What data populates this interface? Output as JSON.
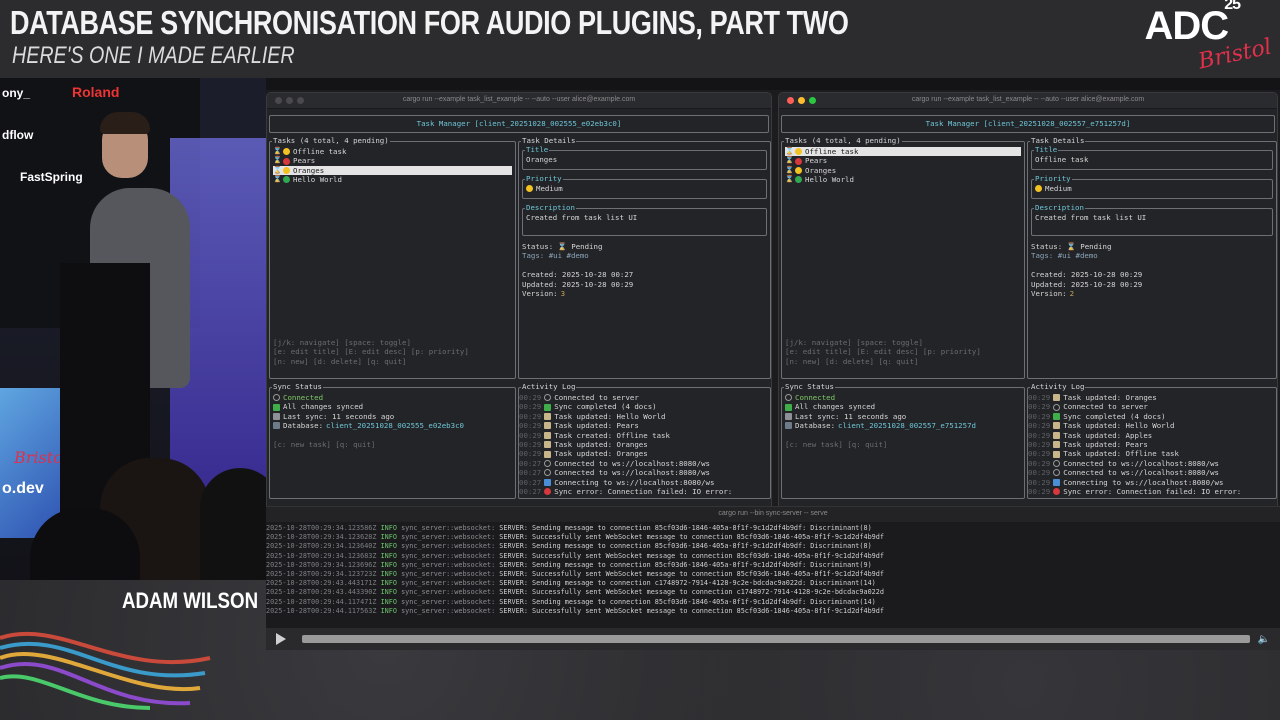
{
  "slide": {
    "title": "DATABASE SYNCHRONISATION FOR AUDIO PLUGINS, PART TWO",
    "subtitle": "HERE'S ONE I MADE EARLIER",
    "logo": "ADC",
    "logo_year": "25",
    "logo_city": "Bristol",
    "speaker_name": "ADAM WILSON",
    "sponsors": [
      "ony_",
      "Roland",
      "dflow",
      "FastSpring"
    ],
    "stage_text": [
      "Bristol",
      "o.dev"
    ]
  },
  "windows": [
    {
      "title": "cargo run --example task_list_example -- --auto --user alice@example.com",
      "active": false,
      "header": "Task Manager [client_20251028_002555_e02eb3c0]",
      "tasks_label": "Tasks (4 total, 4 pending)",
      "tasks": [
        {
          "name": "Offline task",
          "color": "yellow",
          "selected": false
        },
        {
          "name": "Pears",
          "color": "red",
          "selected": false
        },
        {
          "name": "Oranges",
          "color": "yellow",
          "selected": true
        },
        {
          "name": "Hello World",
          "color": "green",
          "selected": false
        }
      ],
      "help": [
        "[j/k: navigate] [space: toggle]",
        "[e: edit title] [E: edit desc] [p: priority]",
        "[n: new] [d: delete] [q: quit]"
      ],
      "details_label": "Task Details",
      "title_label": "Title",
      "title_value": "Oranges",
      "priority_label": "Priority",
      "priority_value": "Medium",
      "description_label": "Description",
      "description_value": "Created from task list UI",
      "status_line": "Status: ⌛ Pending",
      "tags_line": "Tags: #ui #demo",
      "created_line": "Created: 2025-10-28 00:27",
      "updated_line": "Updated: 2025-10-28 00:29",
      "version_label": "Version:",
      "version_value": "3",
      "sync_label": "Sync Status",
      "sync_connected": "Connected",
      "sync_changes": "All changes synced",
      "sync_last": "Last sync: 11 seconds ago",
      "sync_db_label": "Database:",
      "sync_db_value": "client_20251028_002555_e02eb3c0",
      "sync_help": "[c: new task] [q: quit]",
      "activity_label": "Activity Log",
      "activity": [
        {
          "ts": "00:29",
          "icon": "link",
          "text": "Connected to server"
        },
        {
          "ts": "00:29",
          "icon": "check",
          "text": "Sync completed (4 docs)"
        },
        {
          "ts": "00:29",
          "icon": "doc",
          "text": "Task updated: Hello World"
        },
        {
          "ts": "00:29",
          "icon": "doc",
          "text": "Task updated: Pears"
        },
        {
          "ts": "00:29",
          "icon": "doc",
          "text": "Task created: Offline task"
        },
        {
          "ts": "00:29",
          "icon": "doc",
          "text": "Task updated: Oranges"
        },
        {
          "ts": "00:29",
          "icon": "doc",
          "text": "Task updated: Oranges"
        },
        {
          "ts": "00:27",
          "icon": "link",
          "text": "Connected to ws://localhost:8080/ws"
        },
        {
          "ts": "00:27",
          "icon": "link",
          "text": "Connected to ws://localhost:8080/ws"
        },
        {
          "ts": "00:27",
          "icon": "blue",
          "text": "Connecting to ws://localhost:8080/ws"
        },
        {
          "ts": "00:27",
          "icon": "err",
          "text": "Sync error: Connection failed: IO error:"
        }
      ]
    },
    {
      "title": "cargo run --example task_list_example -- --auto --user alice@example.com",
      "active": true,
      "header": "Task Manager [client_20251028_002557_e751257d]",
      "tasks_label": "Tasks (4 total, 4 pending)",
      "tasks": [
        {
          "name": "Offline task",
          "color": "yellow",
          "selected": true
        },
        {
          "name": "Pears",
          "color": "red",
          "selected": false
        },
        {
          "name": "Oranges",
          "color": "yellow",
          "selected": false
        },
        {
          "name": "Hello World",
          "color": "green",
          "selected": false
        }
      ],
      "help": [
        "[j/k: navigate] [space: toggle]",
        "[e: edit title] [E: edit desc] [p: priority]",
        "[n: new] [d: delete] [q: quit]"
      ],
      "details_label": "Task Details",
      "title_label": "Title",
      "title_value": "Offline task",
      "priority_label": "Priority",
      "priority_value": "Medium",
      "description_label": "Description",
      "description_value": "Created from task list UI",
      "status_line": "Status: ⌛ Pending",
      "tags_line": "Tags: #ui #demo",
      "created_line": "Created: 2025-10-28 00:29",
      "updated_line": "Updated: 2025-10-28 00:29",
      "version_label": "Version:",
      "version_value": "2",
      "sync_label": "Sync Status",
      "sync_connected": "Connected",
      "sync_changes": "All changes synced",
      "sync_last": "Last sync: 11 seconds ago",
      "sync_db_label": "Database:",
      "sync_db_value": "client_20251028_002557_e751257d",
      "sync_help": "[c: new task] [q: quit]",
      "activity_label": "Activity Log",
      "activity": [
        {
          "ts": "00:29",
          "icon": "doc",
          "text": "Task updated: Oranges"
        },
        {
          "ts": "00:29",
          "icon": "link",
          "text": "Connected to server"
        },
        {
          "ts": "00:29",
          "icon": "check",
          "text": "Sync completed (4 docs)"
        },
        {
          "ts": "00:29",
          "icon": "doc",
          "text": "Task updated: Hello World"
        },
        {
          "ts": "00:29",
          "icon": "doc",
          "text": "Task updated: Apples"
        },
        {
          "ts": "00:29",
          "icon": "doc",
          "text": "Task updated: Pears"
        },
        {
          "ts": "00:29",
          "icon": "doc",
          "text": "Task updated: Offline task"
        },
        {
          "ts": "00:29",
          "icon": "link",
          "text": "Connected to ws://localhost:8080/ws"
        },
        {
          "ts": "00:29",
          "icon": "link",
          "text": "Connected to ws://localhost:8080/ws"
        },
        {
          "ts": "00:29",
          "icon": "blue",
          "text": "Connecting to ws://localhost:8080/ws"
        },
        {
          "ts": "00:29",
          "icon": "err",
          "text": "Sync error: Connection failed: IO error:"
        }
      ]
    }
  ],
  "server": {
    "title": "cargo run --bin sync-server -- serve",
    "logs": [
      {
        "ts": "2025-10-28T00:29:34.123586Z",
        "level": "INFO",
        "module": "sync_server::websocket:",
        "msg": "SERVER: Sending message to connection 85cf03d6-1846-405a-8f1f-9c1d2df4b9df: Discriminant(8)"
      },
      {
        "ts": "2025-10-28T00:29:34.123628Z",
        "level": "INFO",
        "module": "sync_server::websocket:",
        "msg": "SERVER: Successfully sent WebSocket message to connection 85cf03d6-1846-405a-8f1f-9c1d2df4b9df"
      },
      {
        "ts": "2025-10-28T00:29:34.123640Z",
        "level": "INFO",
        "module": "sync_server::websocket:",
        "msg": "SERVER: Sending message to connection 85cf03d6-1846-405a-8f1f-9c1d2df4b9df: Discriminant(8)"
      },
      {
        "ts": "2025-10-28T00:29:34.123683Z",
        "level": "INFO",
        "module": "sync_server::websocket:",
        "msg": "SERVER: Successfully sent WebSocket message to connection 85cf03d6-1846-405a-8f1f-9c1d2df4b9df"
      },
      {
        "ts": "2025-10-28T00:29:34.123696Z",
        "level": "INFO",
        "module": "sync_server::websocket:",
        "msg": "SERVER: Sending message to connection 85cf03d6-1846-405a-8f1f-9c1d2df4b9df: Discriminant(9)"
      },
      {
        "ts": "2025-10-28T00:29:34.123723Z",
        "level": "INFO",
        "module": "sync_server::websocket:",
        "msg": "SERVER: Successfully sent WebSocket message to connection 85cf03d6-1846-405a-8f1f-9c1d2df4b9df"
      },
      {
        "ts": "2025-10-28T00:29:43.443171Z",
        "level": "INFO",
        "module": "sync_server::websocket:",
        "msg": "SERVER: Sending message to connection c1748972-7914-4128-9c2e-bdcdac9a022d: Discriminant(14)"
      },
      {
        "ts": "2025-10-28T00:29:43.443390Z",
        "level": "INFO",
        "module": "sync_server::websocket:",
        "msg": "SERVER: Successfully sent WebSocket message to connection c1748972-7914-4128-9c2e-bdcdac9a022d"
      },
      {
        "ts": "2025-10-28T00:29:44.117471Z",
        "level": "INFO",
        "module": "sync_server::websocket:",
        "msg": "SERVER: Sending message to connection 85cf03d6-1846-405a-8f1f-9c1d2df4b9df: Discriminant(14)"
      },
      {
        "ts": "2025-10-28T00:29:44.117563Z",
        "level": "INFO",
        "module": "sync_server::websocket:",
        "msg": "SERVER: Successfully sent WebSocket message to connection 85cf03d6-1846-405a-8f1f-9c1d2df4b9df"
      }
    ]
  },
  "player": {
    "play_icon": "play-icon",
    "volume_icon": "volume-icon"
  }
}
